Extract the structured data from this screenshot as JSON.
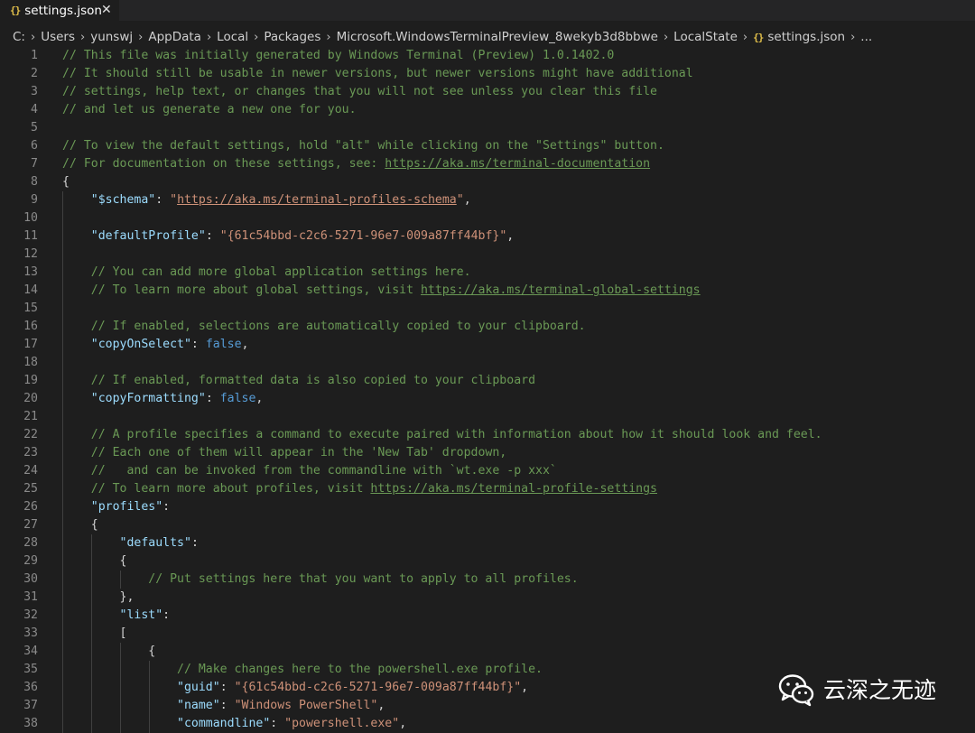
{
  "tab": {
    "icon": "json-braces-icon",
    "label": "settings.json",
    "close_icon": "close-icon"
  },
  "breadcrumb": {
    "items": [
      "C:",
      "Users",
      "yunswj",
      "AppData",
      "Local",
      "Packages",
      "Microsoft.WindowsTerminalPreview_8wekyb3d8bbwe",
      "LocalState",
      "settings.json",
      "..."
    ],
    "file_icon": "json-braces-icon",
    "separator_icon": "chevron-right-icon"
  },
  "editor": {
    "lines": [
      {
        "n": "1",
        "tokens": [
          {
            "t": "// This file was initially generated by Windows Terminal (Preview) 1.0.1402.0",
            "k": "comment"
          }
        ]
      },
      {
        "n": "2",
        "tokens": [
          {
            "t": "// It should still be usable in newer versions, but newer versions might have additional",
            "k": "comment"
          }
        ]
      },
      {
        "n": "3",
        "tokens": [
          {
            "t": "// settings, help text, or changes that you will not see unless you clear this file",
            "k": "comment"
          }
        ]
      },
      {
        "n": "4",
        "tokens": [
          {
            "t": "// and let us generate a new one for you.",
            "k": "comment"
          }
        ]
      },
      {
        "n": "5",
        "tokens": []
      },
      {
        "n": "6",
        "tokens": [
          {
            "t": "// To view the default settings, hold \"alt\" while clicking on the \"Settings\" button.",
            "k": "comment"
          }
        ]
      },
      {
        "n": "7",
        "tokens": [
          {
            "t": "// For documentation on these settings, see: ",
            "k": "comment"
          },
          {
            "t": "https://aka.ms/terminal-documentation",
            "k": "link"
          }
        ]
      },
      {
        "n": "8",
        "tokens": [
          {
            "t": "{",
            "k": "punct"
          }
        ]
      },
      {
        "n": "9",
        "tokens": [
          {
            "t": "    ",
            "k": "punct"
          },
          {
            "t": "\"$schema\"",
            "k": "key"
          },
          {
            "t": ": ",
            "k": "punct"
          },
          {
            "t": "\"",
            "k": "str"
          },
          {
            "t": "https://aka.ms/terminal-profiles-schema",
            "k": "linkstr"
          },
          {
            "t": "\"",
            "k": "str"
          },
          {
            "t": ",",
            "k": "punct"
          }
        ]
      },
      {
        "n": "10",
        "tokens": []
      },
      {
        "n": "11",
        "tokens": [
          {
            "t": "    ",
            "k": "punct"
          },
          {
            "t": "\"defaultProfile\"",
            "k": "key"
          },
          {
            "t": ": ",
            "k": "punct"
          },
          {
            "t": "\"{61c54bbd-c2c6-5271-96e7-009a87ff44bf}\"",
            "k": "str"
          },
          {
            "t": ",",
            "k": "punct"
          }
        ]
      },
      {
        "n": "12",
        "tokens": []
      },
      {
        "n": "13",
        "tokens": [
          {
            "t": "    // You can add more global application settings here.",
            "k": "comment"
          }
        ]
      },
      {
        "n": "14",
        "tokens": [
          {
            "t": "    // To learn more about global settings, visit ",
            "k": "comment"
          },
          {
            "t": "https://aka.ms/terminal-global-settings",
            "k": "link"
          }
        ]
      },
      {
        "n": "15",
        "tokens": []
      },
      {
        "n": "16",
        "tokens": [
          {
            "t": "    // If enabled, selections are automatically copied to your clipboard.",
            "k": "comment"
          }
        ]
      },
      {
        "n": "17",
        "tokens": [
          {
            "t": "    ",
            "k": "punct"
          },
          {
            "t": "\"copyOnSelect\"",
            "k": "key"
          },
          {
            "t": ": ",
            "k": "punct"
          },
          {
            "t": "false",
            "k": "bool"
          },
          {
            "t": ",",
            "k": "punct"
          }
        ]
      },
      {
        "n": "18",
        "tokens": []
      },
      {
        "n": "19",
        "tokens": [
          {
            "t": "    // If enabled, formatted data is also copied to your clipboard",
            "k": "comment"
          }
        ]
      },
      {
        "n": "20",
        "tokens": [
          {
            "t": "    ",
            "k": "punct"
          },
          {
            "t": "\"copyFormatting\"",
            "k": "key"
          },
          {
            "t": ": ",
            "k": "punct"
          },
          {
            "t": "false",
            "k": "bool"
          },
          {
            "t": ",",
            "k": "punct"
          }
        ]
      },
      {
        "n": "21",
        "tokens": []
      },
      {
        "n": "22",
        "tokens": [
          {
            "t": "    // A profile specifies a command to execute paired with information about how it should look and feel.",
            "k": "comment"
          }
        ]
      },
      {
        "n": "23",
        "tokens": [
          {
            "t": "    // Each one of them will appear in the 'New Tab' dropdown,",
            "k": "comment"
          }
        ]
      },
      {
        "n": "24",
        "tokens": [
          {
            "t": "    //   and can be invoked from the commandline with `wt.exe -p xxx`",
            "k": "comment"
          }
        ]
      },
      {
        "n": "25",
        "tokens": [
          {
            "t": "    // To learn more about profiles, visit ",
            "k": "comment"
          },
          {
            "t": "https://aka.ms/terminal-profile-settings",
            "k": "link"
          }
        ]
      },
      {
        "n": "26",
        "tokens": [
          {
            "t": "    ",
            "k": "punct"
          },
          {
            "t": "\"profiles\"",
            "k": "key"
          },
          {
            "t": ":",
            "k": "punct"
          }
        ]
      },
      {
        "n": "27",
        "tokens": [
          {
            "t": "    {",
            "k": "punct"
          }
        ]
      },
      {
        "n": "28",
        "tokens": [
          {
            "t": "        ",
            "k": "punct"
          },
          {
            "t": "\"defaults\"",
            "k": "key"
          },
          {
            "t": ":",
            "k": "punct"
          }
        ]
      },
      {
        "n": "29",
        "tokens": [
          {
            "t": "        {",
            "k": "punct"
          }
        ]
      },
      {
        "n": "30",
        "tokens": [
          {
            "t": "            // Put settings here that you want to apply to all profiles.",
            "k": "comment"
          }
        ]
      },
      {
        "n": "31",
        "tokens": [
          {
            "t": "        },",
            "k": "punct"
          }
        ]
      },
      {
        "n": "32",
        "tokens": [
          {
            "t": "        ",
            "k": "punct"
          },
          {
            "t": "\"list\"",
            "k": "key"
          },
          {
            "t": ":",
            "k": "punct"
          }
        ]
      },
      {
        "n": "33",
        "tokens": [
          {
            "t": "        [",
            "k": "punct"
          }
        ]
      },
      {
        "n": "34",
        "tokens": [
          {
            "t": "            {",
            "k": "punct"
          }
        ]
      },
      {
        "n": "35",
        "tokens": [
          {
            "t": "                // Make changes here to the powershell.exe profile.",
            "k": "comment"
          }
        ]
      },
      {
        "n": "36",
        "tokens": [
          {
            "t": "                ",
            "k": "punct"
          },
          {
            "t": "\"guid\"",
            "k": "key"
          },
          {
            "t": ": ",
            "k": "punct"
          },
          {
            "t": "\"{61c54bbd-c2c6-5271-96e7-009a87ff44bf}\"",
            "k": "str"
          },
          {
            "t": ",",
            "k": "punct"
          }
        ]
      },
      {
        "n": "37",
        "tokens": [
          {
            "t": "                ",
            "k": "punct"
          },
          {
            "t": "\"name\"",
            "k": "key"
          },
          {
            "t": ": ",
            "k": "punct"
          },
          {
            "t": "\"Windows PowerShell\"",
            "k": "str"
          },
          {
            "t": ",",
            "k": "punct"
          }
        ]
      },
      {
        "n": "38",
        "tokens": [
          {
            "t": "                ",
            "k": "punct"
          },
          {
            "t": "\"commandline\"",
            "k": "key"
          },
          {
            "t": ": ",
            "k": "punct"
          },
          {
            "t": "\"powershell.exe\"",
            "k": "str"
          },
          {
            "t": ",",
            "k": "punct"
          }
        ]
      }
    ]
  },
  "watermark": {
    "icon": "wechat-icon",
    "text": "云深之无迹"
  },
  "colors": {
    "background": "#1e1e1e",
    "comment": "#6a9955",
    "key": "#9cdcfe",
    "string": "#ce9178",
    "boolean": "#569cd6",
    "json_icon": "#e2c04a"
  }
}
